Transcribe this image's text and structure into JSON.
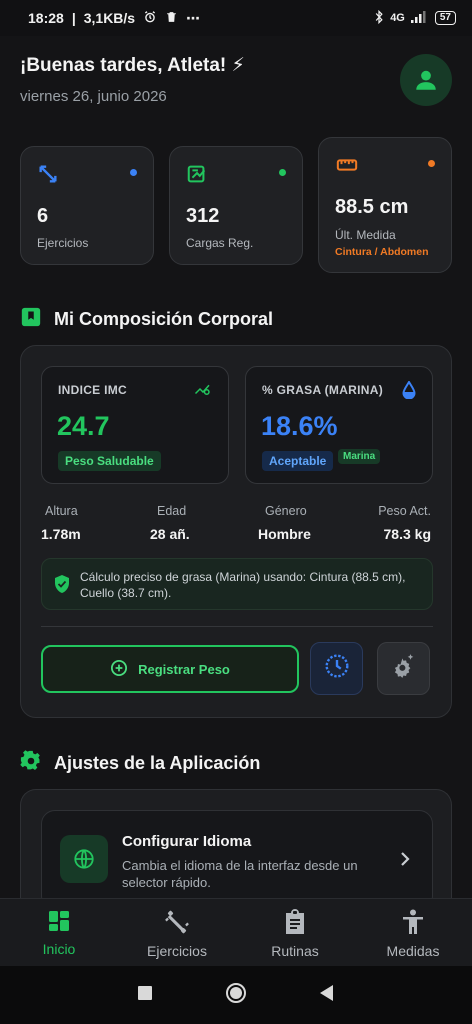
{
  "status_bar": {
    "time": "18:28",
    "speed": "3,1KB/s",
    "network": "4G",
    "battery": "57"
  },
  "header": {
    "greeting": "¡Buenas tardes, Atleta! ⚡",
    "date": "viernes 26, junio 2026"
  },
  "stats": [
    {
      "value": "6",
      "label": "Ejercicios",
      "icon": "arrows-diagonal-icon",
      "color": "#3b82f6"
    },
    {
      "value": "312",
      "label": "Cargas Reg.",
      "icon": "weight-log-icon",
      "color": "#22c55e"
    },
    {
      "value": "88.5 cm",
      "label": "Últ. Medida",
      "sub": "Cintura / Abdomen",
      "icon": "ruler-icon",
      "color": "#f07a25"
    }
  ],
  "body_comp": {
    "title": "Mi Composición Corporal",
    "imc": {
      "label": "INDICE IMC",
      "value": "24.7",
      "badge": "Peso Saludable"
    },
    "grasa": {
      "label": "% GRASA (MARINA)",
      "value": "18.6%",
      "badge": "Aceptable",
      "badge2": "Marina"
    },
    "info": [
      {
        "label": "Altura",
        "value": "1.78m"
      },
      {
        "label": "Edad",
        "value": "28 añ."
      },
      {
        "label": "Género",
        "value": "Hombre"
      },
      {
        "label": "Peso Act.",
        "value": "78.3 kg"
      }
    ],
    "notice": "Cálculo preciso de grasa (Marina) usando: Cintura (88.5 cm), Cuello (38.7 cm).",
    "register_button": "Registrar Peso"
  },
  "settings": {
    "title": "Ajustes de la Aplicación",
    "item": {
      "title": "Configurar Idioma",
      "description": "Cambia el idioma de la interfaz desde un selector rápido."
    }
  },
  "nav": [
    {
      "label": "Inicio",
      "icon": "dashboard-icon",
      "active": true
    },
    {
      "label": "Ejercicios",
      "icon": "dumbbell-icon"
    },
    {
      "label": "Rutinas",
      "icon": "clipboard-icon"
    },
    {
      "label": "Medidas",
      "icon": "person-icon"
    }
  ],
  "colors": {
    "accent": "#22c55e",
    "blue": "#3b82f6",
    "orange": "#f07a25",
    "background": "#141416"
  }
}
